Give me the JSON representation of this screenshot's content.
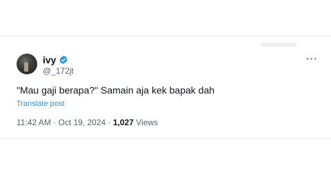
{
  "user": {
    "name": "ivy",
    "handle": "@_172jt",
    "avatar_icon": "avatar-photo-icon",
    "verified_icon": "verified-badge-icon"
  },
  "post": {
    "text": "\"Mau gaji berapa?\" Samain aja kek bapak dah",
    "translate_label": "Translate post",
    "time": "11:42 AM",
    "separator": " · ",
    "date": "Oct 19, 2024",
    "views_count": "1,027",
    "views_label": " Views"
  },
  "menu": {
    "more_label": "···",
    "more_icon": "more-options-icon"
  },
  "colors": {
    "link": "#1d9bf0",
    "secondary": "#536471",
    "primary": "#0f1419"
  }
}
